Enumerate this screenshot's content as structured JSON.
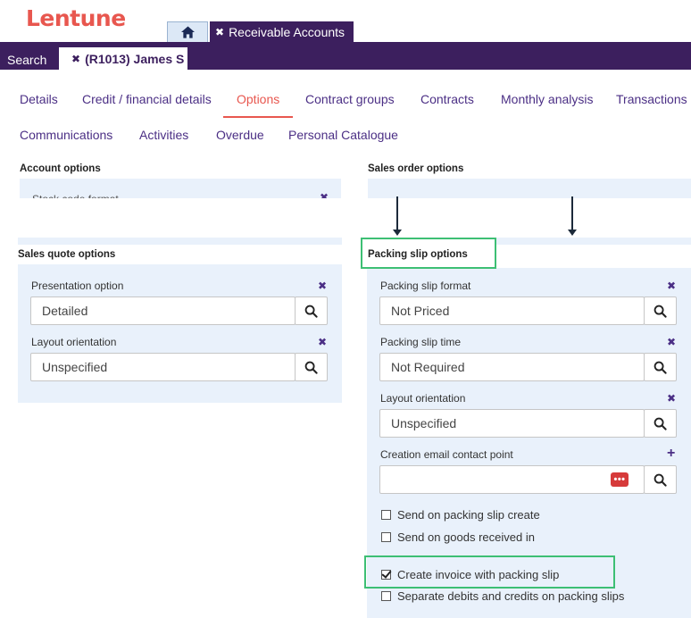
{
  "brand": {
    "logo": "Lentune"
  },
  "top_tabs": {
    "receivable_label": "Receivable Accounts"
  },
  "sub_tabs": {
    "search_label": "Search",
    "customer_label": "(R1013) James S"
  },
  "nav": {
    "details": "Details",
    "credit": "Credit / financial details",
    "options": "Options",
    "contract_groups": "Contract groups",
    "contracts": "Contracts",
    "monthly_analysis": "Monthly analysis",
    "transactions": "Transactions",
    "communications": "Communications",
    "activities": "Activities",
    "overdue": "Overdue",
    "personal_catalogue": "Personal Catalogue"
  },
  "account_options": {
    "title": "Account options",
    "partial_label": "Stock code format"
  },
  "sales_order_options": {
    "title": "Sales order options"
  },
  "sales_quote_options": {
    "title": "Sales quote options",
    "presentation_label": "Presentation option",
    "presentation_value": "Detailed",
    "layout_label": "Layout orientation",
    "layout_value": "Unspecified"
  },
  "packing_slip_options": {
    "title": "Packing slip options",
    "format_label": "Packing slip format",
    "format_value": "Not Priced",
    "time_label": "Packing slip time",
    "time_value": "Not Required",
    "layout_label": "Layout orientation",
    "layout_value": "Unspecified",
    "email_label": "Creation email contact point",
    "email_value": "",
    "checkboxes": {
      "send_on_create": "Send on packing slip create",
      "send_on_goods_received": "Send on goods received in",
      "create_invoice": "Create invoice with packing slip",
      "separate_debits": "Separate debits and credits on packing slips"
    }
  },
  "colors": {
    "brand": "#e8574f",
    "header": "#3c1f5e",
    "panel": "#e9f1fb",
    "highlight": "#3dbf74"
  }
}
